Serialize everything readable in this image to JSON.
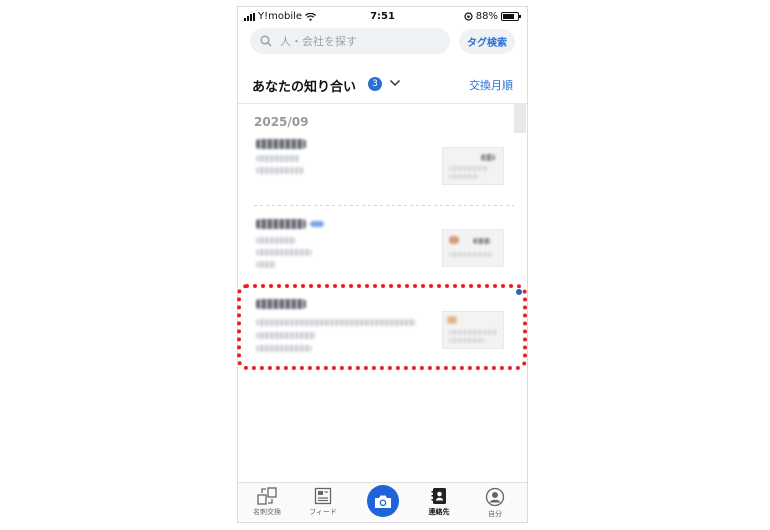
{
  "status_bar": {
    "carrier": "Y!mobile",
    "time": "7:51",
    "battery": "88%"
  },
  "search": {
    "placeholder": "人・会社を探す",
    "tag_button": "タグ検索"
  },
  "section": {
    "title": "あなたの知り合い",
    "count": "3",
    "sort_label": "交換月順"
  },
  "list": {
    "month": "2025/09",
    "contacts_count": 3
  },
  "tabs": [
    {
      "label": "名刺交換",
      "icon": "card-exchange-icon"
    },
    {
      "label": "フィード",
      "icon": "feed-icon"
    },
    {
      "label": "",
      "icon": "camera-icon"
    },
    {
      "label": "連絡先",
      "icon": "contacts-icon"
    },
    {
      "label": "自分",
      "icon": "profile-icon"
    }
  ],
  "colors": {
    "accent": "#2b6fd6",
    "highlight": "#e32424",
    "camera": "#1e63d9"
  }
}
